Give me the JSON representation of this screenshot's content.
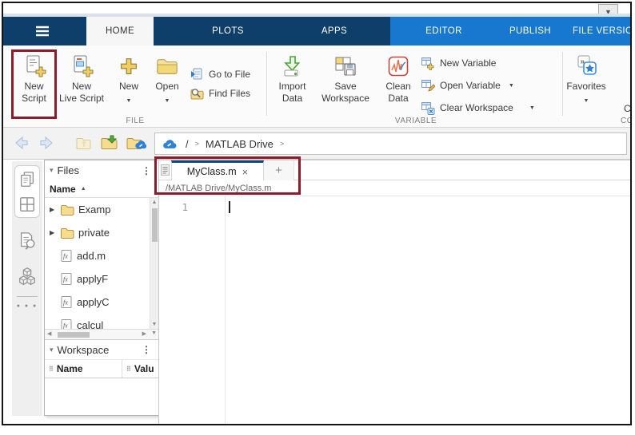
{
  "window": {
    "corner_arrow_icon": "▼"
  },
  "ribbon": {
    "tabs": [
      {
        "label": "HOME",
        "active": true
      },
      {
        "label": "PLOTS",
        "active": false
      },
      {
        "label": "APPS",
        "active": false
      },
      {
        "label": "EDITOR",
        "active": false
      },
      {
        "label": "PUBLISH",
        "active": false
      },
      {
        "label": "FILE VERSION",
        "active": false
      }
    ]
  },
  "toolstrip": {
    "sections": {
      "file": "FILE",
      "variable": "VARIABLE",
      "code_clipped": "CO"
    },
    "new_script": {
      "line1": "New",
      "line2": "Script"
    },
    "new_live_script": {
      "line1": "New",
      "line2": "Live Script"
    },
    "new_label": "New",
    "open_label": "Open",
    "go_to_file": "Go to File",
    "find_files": "Find Files",
    "import_data": {
      "line1": "Import",
      "line2": "Data"
    },
    "save_workspace": {
      "line1": "Save",
      "line2": "Workspace"
    },
    "clean_data": {
      "line1": "Clean",
      "line2": "Data"
    },
    "new_variable": "New Variable",
    "open_variable": "Open Variable",
    "clear_workspace": "Clear Workspace",
    "favorites": "Favorites",
    "clipped_button_label": "C",
    "dropdown_icon": "▼"
  },
  "breadcrumb": {
    "root": "/",
    "chevron": ">",
    "folder": "MATLAB Drive"
  },
  "sidebar": {
    "more_icon": "● ● ●"
  },
  "files_panel": {
    "collapse_icon": "▾",
    "title": "Files",
    "menu_icon": "⋮",
    "name_header": "Name",
    "sort_icon": "▲",
    "fx_glyph": "fx",
    "scroll_up_icon": "▲",
    "scroll_down_icon": "▼",
    "scroll_left_icon": "◀",
    "scroll_right_icon": "▶",
    "items": [
      {
        "name": "Examp",
        "kind": "folder",
        "expander": "▶"
      },
      {
        "name": "private",
        "kind": "folder",
        "expander": "▶"
      },
      {
        "name": "add.m",
        "kind": "function",
        "expander": ""
      },
      {
        "name": "applyF",
        "kind": "function",
        "expander": ""
      },
      {
        "name": "applyC",
        "kind": "function",
        "expander": ""
      },
      {
        "name": "calcul",
        "kind": "function",
        "expander": ""
      }
    ]
  },
  "workspace_panel": {
    "collapse_icon": "▾",
    "title": "Workspace",
    "menu_icon": "⋮",
    "grip_icon": "⠿",
    "columns": {
      "name": "Name",
      "value": "Valu"
    }
  },
  "editor": {
    "tab_title": "MyClass.m",
    "close_icon": "×",
    "new_tab_icon": "+",
    "path": "/MATLAB Drive/MyClass.m",
    "line_number": "1"
  },
  "colors": {
    "ribbon_dark": "#0e3e6a",
    "ribbon_light": "#1878cf",
    "highlight_box": "#8e1b2c"
  }
}
